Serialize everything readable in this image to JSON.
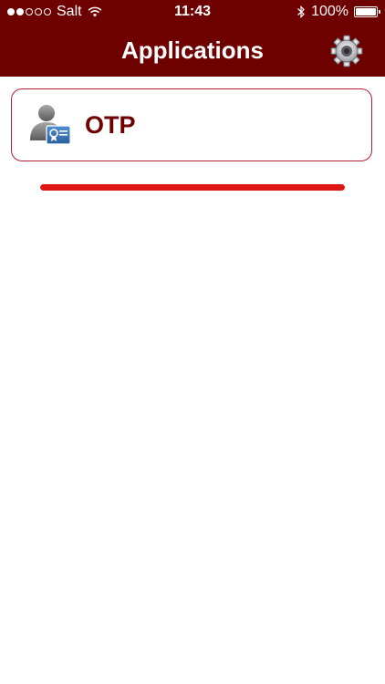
{
  "status_bar": {
    "carrier": "Salt",
    "signal_bars_filled": 2,
    "signal_bars_total": 5,
    "time": "11:43",
    "battery": "100%"
  },
  "nav": {
    "title": "Applications",
    "settings_icon": "gear-icon"
  },
  "apps": [
    {
      "label": "OTP",
      "icon": "user-certificate-icon"
    }
  ],
  "progress": {
    "fraction": 1.0
  },
  "colors": {
    "brand": "#6e0000",
    "card_border": "#b22030",
    "progress": "#e01616",
    "label": "#6e0000"
  }
}
